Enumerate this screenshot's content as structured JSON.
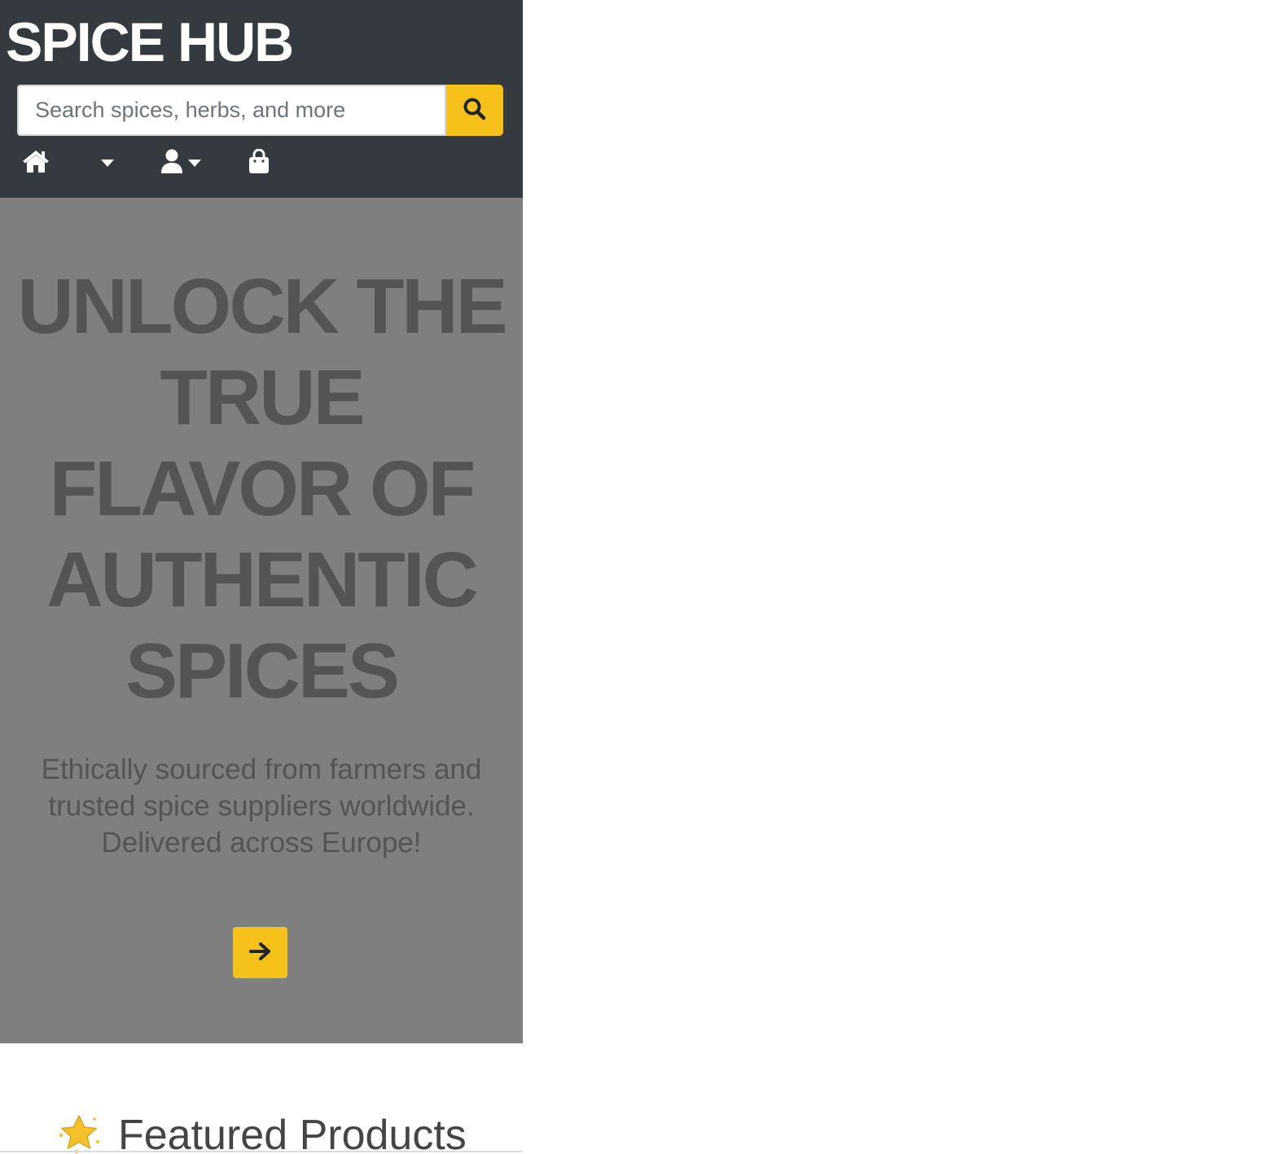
{
  "header": {
    "brand": "SPICE HUB",
    "search": {
      "placeholder": "Search spices, herbs, and more",
      "value": ""
    },
    "icons": {
      "search": "search-icon",
      "home": "home-icon",
      "shop_dropdown": "chevron-down-icon",
      "account": "user-icon",
      "bag": "shopping-bag-icon"
    }
  },
  "hero": {
    "title": "UNLOCK THE TRUE FLAVOR OF AUTHENTIC SPICES",
    "subtitle": "Ethically sourced from farmers and trusted spice suppliers worldwide. Delivered across Europe!",
    "cta_icon": "arrow-right-icon"
  },
  "featured": {
    "icon": "star-icon",
    "title": "Featured Products"
  },
  "colors": {
    "header_bg": "#343a40",
    "accent": "#f6c118",
    "hero_bg": "#7f7f7f",
    "hero_text": "#545454"
  }
}
